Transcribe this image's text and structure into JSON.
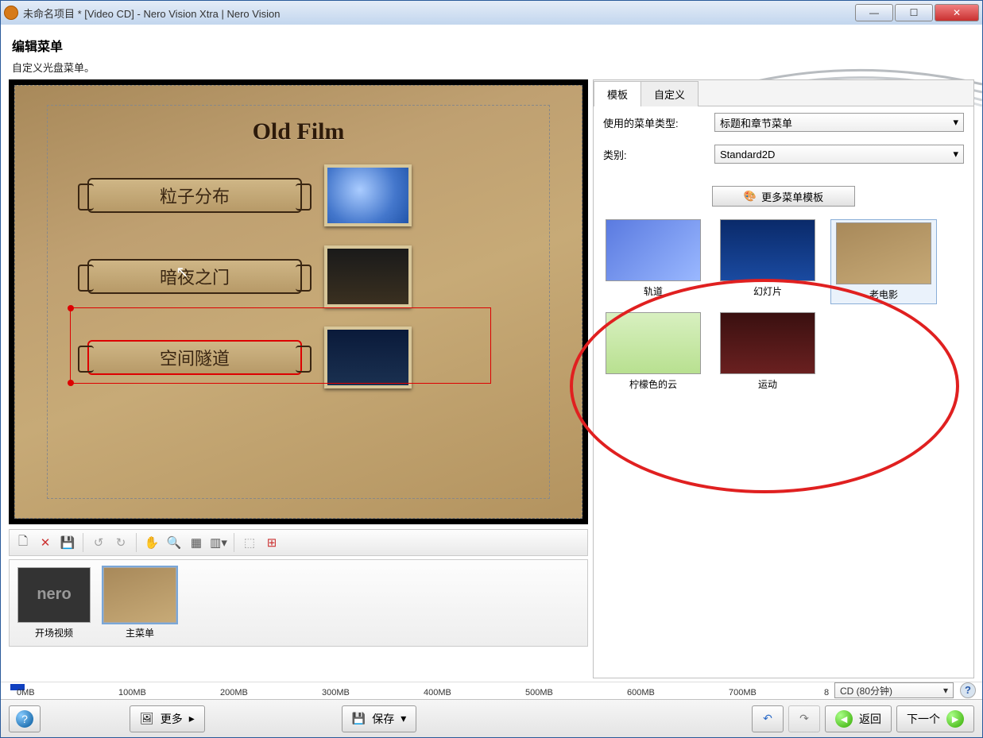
{
  "titlebar": {
    "text": "未命名项目 * [Video CD] - Nero Vision Xtra | Nero Vision"
  },
  "header": {
    "title": "编辑菜单",
    "subtitle": "自定义光盘菜单。"
  },
  "preview": {
    "menu_title": "Old Film",
    "items": [
      {
        "label": "粒子分布"
      },
      {
        "label": "暗夜之门"
      },
      {
        "label": "空间隧道"
      }
    ]
  },
  "nav": {
    "items": [
      {
        "label": "开场视频",
        "logo": "nero"
      },
      {
        "label": "主菜单"
      }
    ]
  },
  "panel": {
    "tabs": [
      "模板",
      "自定义"
    ],
    "menu_type_label": "使用的菜单类型:",
    "menu_type_value": "标题和章节菜单",
    "category_label": "类别:",
    "category_value": "Standard2D",
    "more_templates": "更多菜单模板",
    "templates": [
      {
        "label": "轨道"
      },
      {
        "label": "幻灯片"
      },
      {
        "label": "老电影"
      },
      {
        "label": "柠檬色的云"
      },
      {
        "label": "运动"
      }
    ]
  },
  "ruler": {
    "ticks": [
      "0MB",
      "100MB",
      "200MB",
      "300MB",
      "400MB",
      "500MB",
      "600MB",
      "700MB",
      "8"
    ],
    "disc": "CD (80分钟)"
  },
  "footer": {
    "more": "更多",
    "save": "保存",
    "back": "返回",
    "next": "下一个"
  }
}
